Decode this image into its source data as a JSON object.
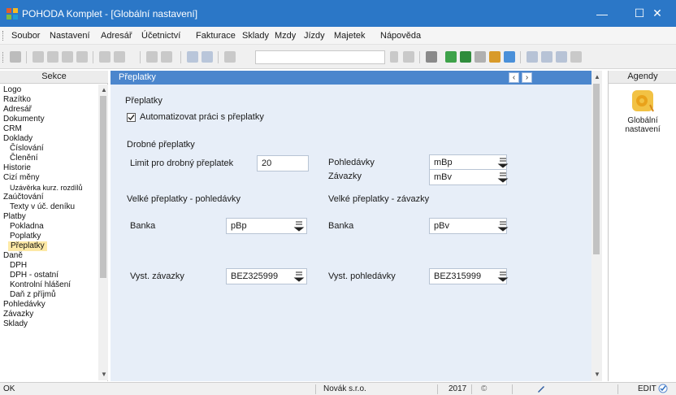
{
  "window": {
    "title": "POHODA Komplet - [Globální nastavení]",
    "minimize": "—",
    "maximize": "☐",
    "close": "✕"
  },
  "menu": [
    "Soubor",
    "Nastavení",
    "Adresář",
    "Účetnictví",
    "Fakturace",
    "Sklady",
    "Mzdy",
    "Jízdy",
    "Majetek",
    "Nápověda"
  ],
  "sections": {
    "header": "Sekce",
    "items": [
      "Logo",
      "Razítko",
      "Adresář",
      "Dokumenty",
      "CRM",
      "Doklady",
      "Číslování",
      "Členění",
      "Historie",
      "Cizí měny",
      "Uzávěrka kurz. rozdílů",
      "Zaúčtování",
      "Texty v úč. deníku",
      "Platby",
      "Pokladna",
      "Poplatky",
      "Přeplatky",
      "Daně",
      "DPH",
      "DPH - ostatní",
      "Kontrolní hlášení",
      "Daň z příjmů",
      "Pohledávky",
      "Závazky",
      "Sklady"
    ],
    "selected": "Přeplatky"
  },
  "content": {
    "header": "Přeplatky",
    "prev": "‹",
    "next": "›",
    "section_title": "Přeplatky",
    "auto_checkbox_label": "Automatizovat práci s přeplatky",
    "auto_checked": true,
    "small_group": "Drobné přeplatky",
    "limit_label": "Limit pro drobný přeplatek",
    "limit_value": "20",
    "receivables_label": "Pohledávky",
    "receivables_value": "mBp",
    "payables_label": "Závazky",
    "payables_value": "mBv",
    "large_recv_group": "Velké přeplatky - pohledávky",
    "large_pay_group": "Velké přeplatky - závazky",
    "bank_label_left": "Banka",
    "bank_value_left": "pBp",
    "bank_label_right": "Banka",
    "bank_value_right": "pBv",
    "vyst_zav_label": "Vyst. závazky",
    "vyst_zav_value": "BEZ325999",
    "vyst_pohl_label": "Vyst. pohledávky",
    "vyst_pohl_value": "BEZ315999"
  },
  "agenda": {
    "header": "Agendy",
    "item_line1": "Globální",
    "item_line2": "nastavení"
  },
  "status": {
    "left": "OK",
    "company": "Novák s.r.o.",
    "year": "2017",
    "mode": "EDIT"
  },
  "colors": {
    "title_bar": "#2b77c7",
    "content_header": "#4b86cd",
    "content_bg": "#e7eef8",
    "selection": "#fde9a6"
  }
}
